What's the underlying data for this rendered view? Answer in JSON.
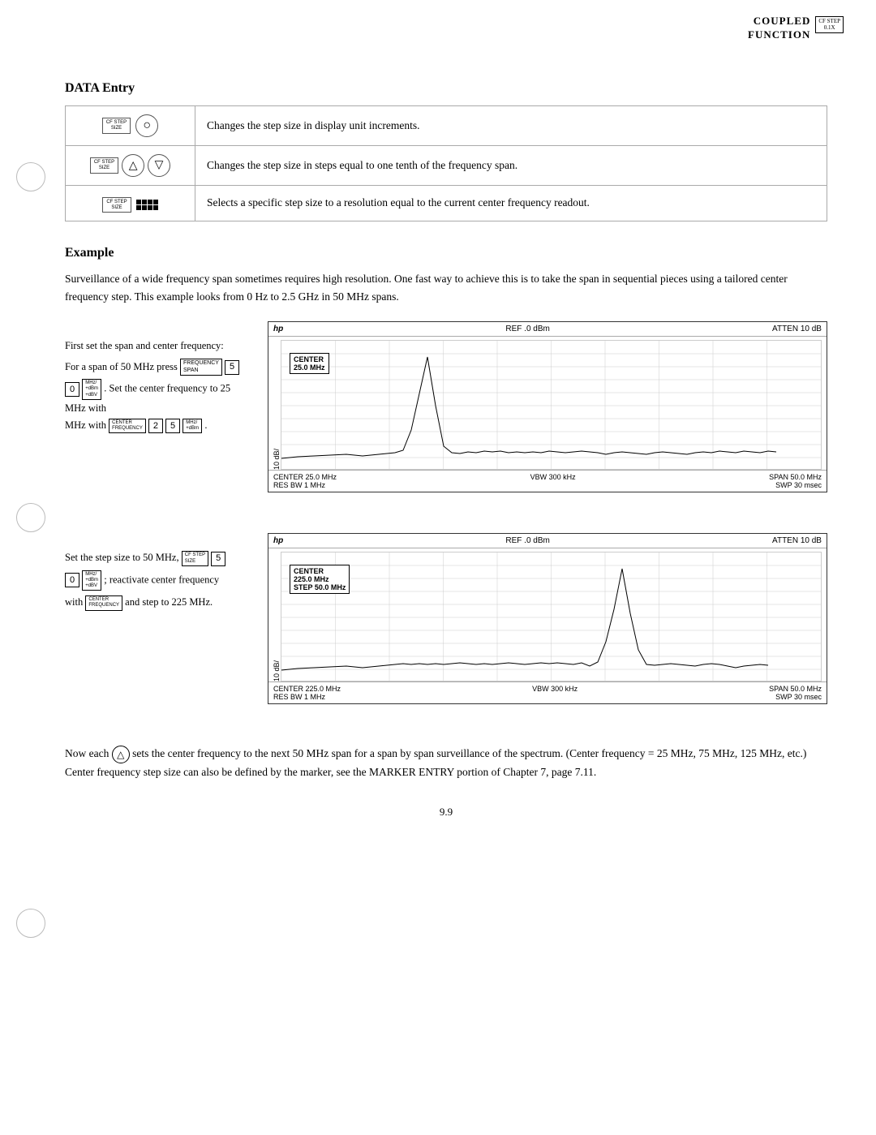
{
  "header": {
    "line1": "COUPLED",
    "line2": "FUNCTION",
    "badge": "CF STEP\n0.1X"
  },
  "section_data_entry": {
    "title": "DATA Entry",
    "rows": [
      {
        "desc": "Changes the step size in display unit increments."
      },
      {
        "desc": "Changes the step size in steps equal to one tenth of the frequency span."
      },
      {
        "desc": "Selects a specific step size to a resolution equal to the current center frequency readout."
      }
    ]
  },
  "section_example": {
    "title": "Example",
    "intro": "Surveillance of a wide frequency span sometimes requires high resolution. One fast way to achieve this is to take the span in sequential pieces using a tailored center frequency step. This example looks from 0 Hz to 2.5 GHz in 50 MHz spans.",
    "block1": {
      "text_before": "First set the span and center frequency:",
      "line1": "For a span of 50 MHz press",
      "line2": "Set the center frequency to 25 MHz with",
      "display": {
        "ref": "REF .0 dBm",
        "atten": "ATTEN 10 dB",
        "scale": "10 dB/",
        "center_label": "CENTER",
        "center_val": "25.0 MHz",
        "footer_center": "CENTER 25.0 MHz",
        "footer_res": "RES BW 1 MHz",
        "footer_vbw": "VBW 300 kHz",
        "footer_span": "SPAN 50.0 MHz",
        "footer_swp": "SWP 30 msec"
      }
    },
    "block2": {
      "line1": "Set the step size to 50 MHz,",
      "line2": "; reactivate center frequency",
      "line3": "with",
      "line4": "and step to 225 MHz.",
      "display": {
        "ref": "REF .0 dBm",
        "atten": "ATTEN 10 dB",
        "scale": "10 dB/",
        "center_label": "CENTER",
        "center_val": "225.0 MHz",
        "step_label": "STEP 50.0 MHz",
        "footer_center": "CENTER 225.0 MHz",
        "footer_res": "RES BW 1 MHz",
        "footer_vbw": "VBW 300 kHz",
        "footer_span": "SPAN 50.0 MHz",
        "footer_swp": "SWP 30 msec"
      }
    }
  },
  "bottom_text": "Now each         sets the center frequency to the next 50 MHz span for a span by span surveillance of the spectrum. (Center frequency = 25 MHz, 75 MHz, 125 MHz, etc.) Center frequency step size can also be defined by the marker, see the MARKER ENTRY portion of Chapter 7, page 7.11.",
  "page_number": "9.9"
}
